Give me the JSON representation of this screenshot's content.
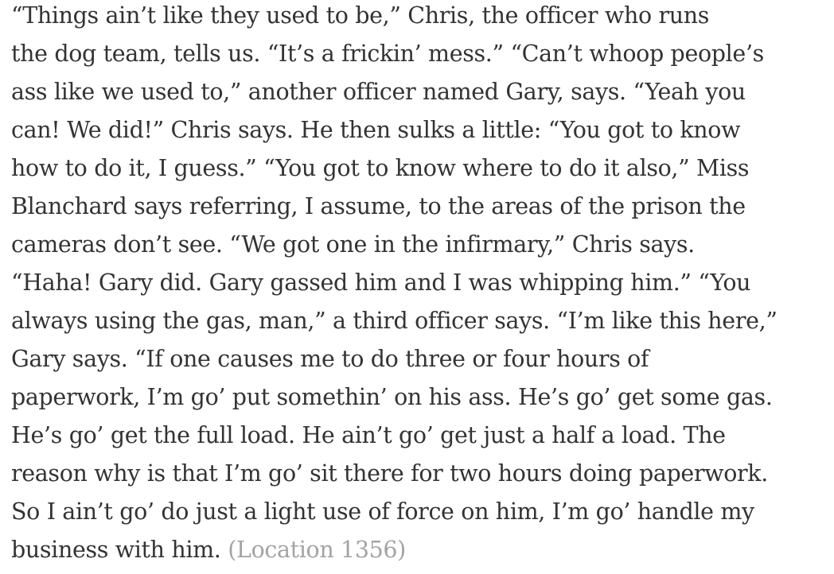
{
  "passage": {
    "lines": [
      "“Things ain’t like they used to be,” Chris, the officer who runs",
      "the dog team, tells us. “It’s a frickin’ mess.” “Can’t whoop people’s",
      "ass like we used to,” another officer named Gary, says. “Yeah you",
      "can! We did!” Chris says. He then sulks a little: “You got to know",
      "how to do it, I guess.” “You got to know where to do it also,” Miss",
      "Blanchard says referring, I assume, to the areas of the prison the",
      "cameras don’t see. “We got one in the infirmary,” Chris says.",
      "“Haha! Gary did. Gary gassed him and I was whipping him.” “You",
      "always using the gas, man,” a third officer says. “I’m like this here,”",
      "Gary says. “If one causes me to do three or four hours of",
      "paperwork, I’m go’ put somethin’ on his ass. He’s go’ get some gas.",
      "He’s go’ get the full load. He ain’t go’ get just a half a load. The",
      "reason why is that I’m go’ sit there for two hours doing paperwork.",
      "So I ain’t go’ do just a light use of force on him, I’m go’ handle my",
      "business with him."
    ],
    "location": "(Location 1356)"
  },
  "colors": {
    "text": "#333333",
    "location": "#a3a3a3",
    "background": "#ffffff"
  }
}
